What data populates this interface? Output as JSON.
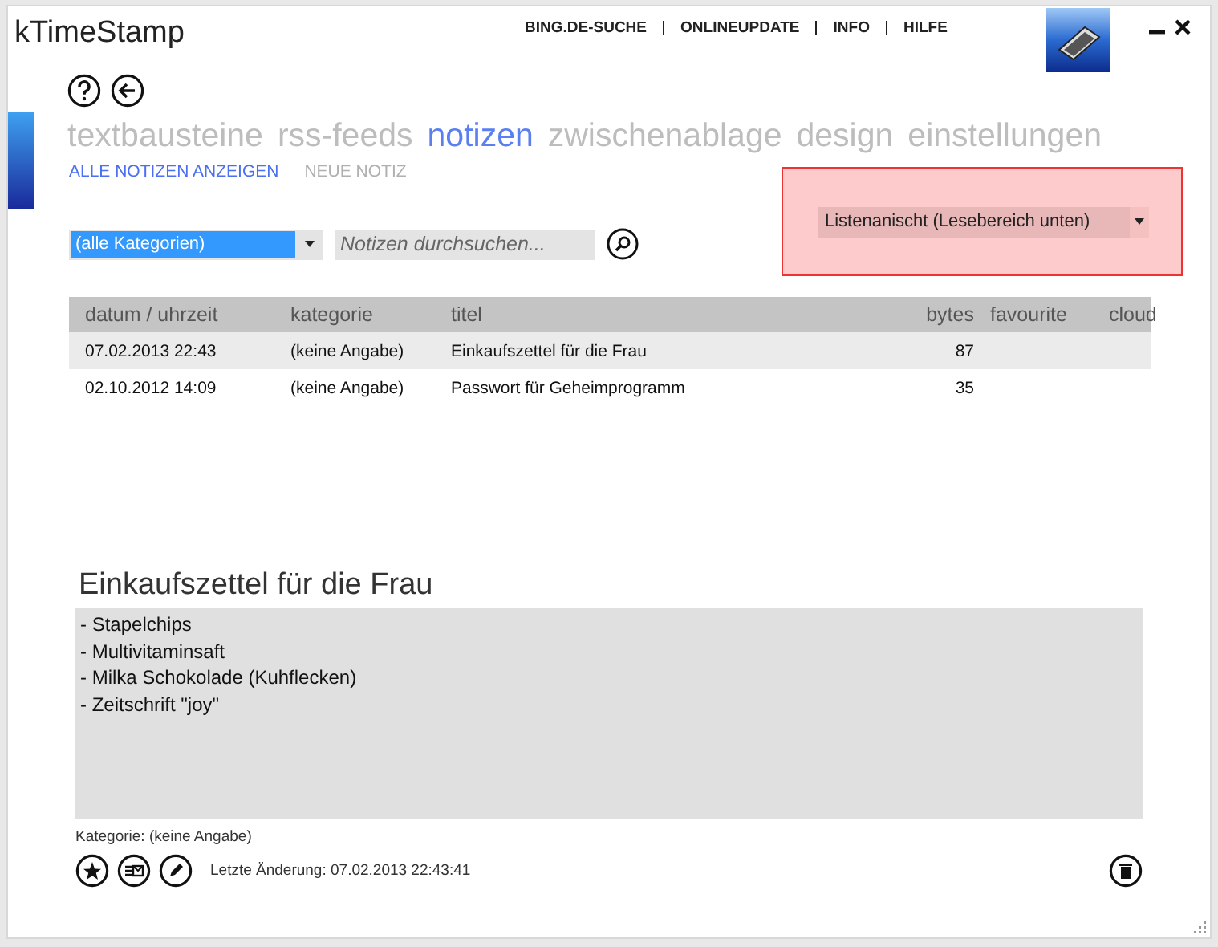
{
  "window": {
    "title": "kTimeStamp"
  },
  "top_links": [
    "BING.DE-SUCHE",
    "ONLINEUPDATE",
    "INFO",
    "HILFE"
  ],
  "tabs": [
    {
      "label": "textbausteine",
      "selected": false
    },
    {
      "label": "rss-feeds",
      "selected": false
    },
    {
      "label": "notizen",
      "selected": true
    },
    {
      "label": "zwischenablage",
      "selected": false
    },
    {
      "label": "design",
      "selected": false
    },
    {
      "label": "einstellungen",
      "selected": false
    }
  ],
  "subtabs": [
    {
      "label": "ALLE NOTIZEN ANZEIGEN",
      "selected": true
    },
    {
      "label": "NEUE NOTIZ",
      "selected": false
    }
  ],
  "category_filter": {
    "value": "(alle Kategorien)"
  },
  "search": {
    "placeholder": "Notizen durchsuchen..."
  },
  "view_select": {
    "value": "Listenanischt (Lesebereich unten)"
  },
  "table": {
    "columns": [
      "datum / uhrzeit",
      "kategorie",
      "titel",
      "bytes",
      "favourite",
      "cloud"
    ],
    "rows": [
      {
        "cells": [
          "07.02.2013 22:43",
          "(keine Angabe)",
          "Einkaufszettel für die Frau",
          "87"
        ],
        "selected": true
      },
      {
        "cells": [
          "02.10.2012 14:09",
          "(keine Angabe)",
          "Passwort für Geheimprogramm",
          "35"
        ],
        "selected": false
      }
    ]
  },
  "note": {
    "title": "Einkaufszettel für die Frau",
    "lines": [
      "- Stapelchips",
      "- Multivitaminsaft",
      "- Milka Schokolade (Kuhflecken)",
      "- Zeitschrift \"joy\""
    ],
    "category": "Kategorie: (keine Angabe)",
    "modified": "Letzte Änderung: 07.02.2013 22:43:41"
  }
}
